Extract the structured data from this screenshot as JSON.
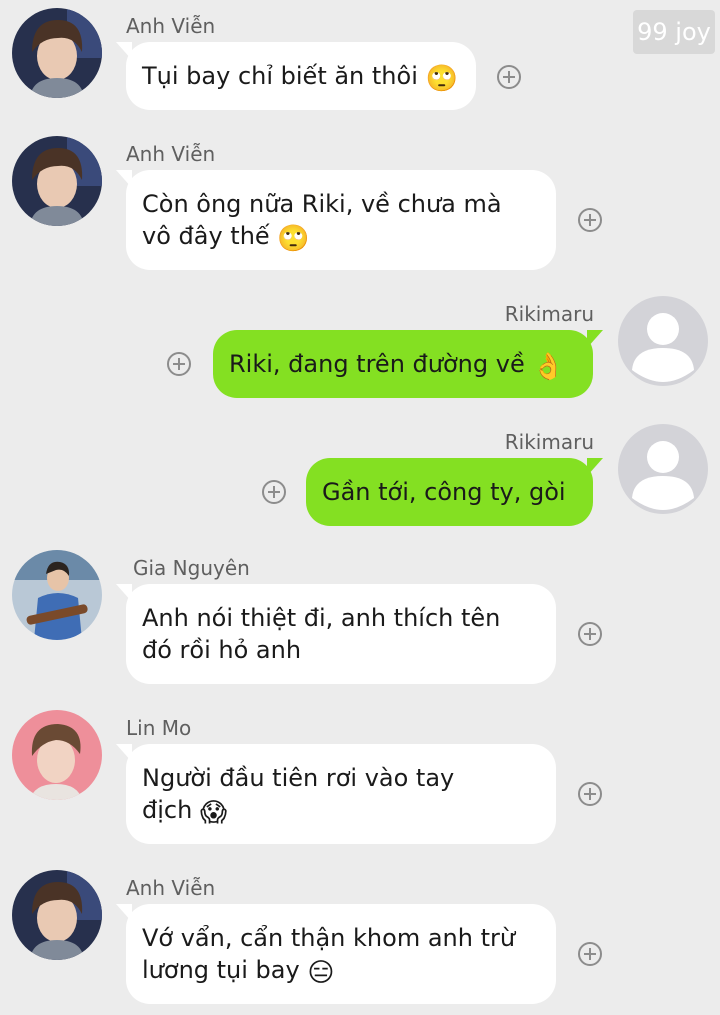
{
  "watermark": "99 joy",
  "messages": [
    {
      "sender": "Anh Viễn",
      "text": "Tụi bay chỉ biết ăn thôi",
      "emoji": "🙄",
      "side": "in"
    },
    {
      "sender": "Anh Viễn",
      "text": "Còn ông nữa Riki, về chưa mà\nvô đây thế",
      "emoji": "🙄",
      "side": "in"
    },
    {
      "sender": "Rikimaru",
      "text": "Riki, đang trên đường về",
      "emoji": "👌",
      "side": "out"
    },
    {
      "sender": "Rikimaru",
      "text": "Gần tới, công ty, gòi",
      "emoji": "",
      "side": "out"
    },
    {
      "sender": "Gia Nguyên",
      "text": "Anh nói thiệt đi, anh thích tên\nđó rồi hỏ anh",
      "emoji": "",
      "side": "in"
    },
    {
      "sender": "Lin Mo",
      "text": "Người đầu tiên rơi vào tay\nđịch",
      "emoji": "😱",
      "side": "in"
    },
    {
      "sender": "Anh Viễn",
      "text": "Vớ vẩn, cẩn thận khom anh trừ\nlương tụi bay",
      "emoji": "😑",
      "side": "in"
    }
  ],
  "colors": {
    "background": "#ececec",
    "incoming_bubble": "#ffffff",
    "outgoing_bubble": "#84e022",
    "default_avatar": "#d3d3d8"
  }
}
